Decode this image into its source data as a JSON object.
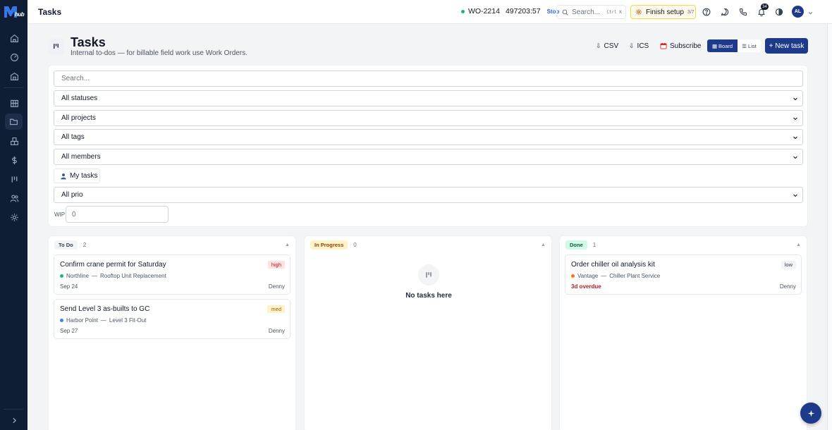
{
  "topbar": {
    "page_title": "Tasks",
    "timer": {
      "work_order": "WO-2214",
      "elapsed": "497203:57",
      "stop_label": "Stop"
    },
    "search_placeholder": "Search...",
    "search_shortcut": "Ctrl K",
    "setup_label": "Finish setup",
    "setup_progress": "3/7",
    "notifications_count": "34",
    "avatar_initials": "AL"
  },
  "brand": {
    "logo_text": "MEPhub"
  },
  "header": {
    "title": "Tasks",
    "subtitle": "Internal to-dos — for billable field work use Work Orders.",
    "csv_label": "CSV",
    "ics_label": "ICS",
    "subscribe_label": "Subscribe",
    "view_board_label": "Board",
    "view_list_label": "List",
    "new_task_label": "+ New task"
  },
  "filters": {
    "search_placeholder": "Search...",
    "status": "All statuses",
    "projects": "All projects",
    "tags": "All tags",
    "members": "All members",
    "my_tasks_label": "My tasks",
    "priority": "All prio",
    "wip_label": "WIP",
    "wip_value": "0"
  },
  "board": {
    "columns": [
      {
        "status": "To Do",
        "count": "2",
        "chip_bg": "#f3f4f6",
        "chip_fg": "#374151",
        "cards": [
          {
            "title": "Confirm crane permit for Saturday",
            "priority": "high",
            "client": "Northline",
            "project": "Rooftop Unit Replacement",
            "due": "Sep 24",
            "assignee": "Denny"
          },
          {
            "title": "Send Level 3 as-builts to GC",
            "priority": "med",
            "client": "Harbor Point",
            "project": "Level 3 Fit-Out",
            "due": "Sep 27",
            "assignee": "Denny"
          }
        ]
      },
      {
        "status": "In Progress",
        "count": "0",
        "chip_bg": "#fef3c7",
        "chip_fg": "#92400e",
        "empty_text": "No tasks here"
      },
      {
        "status": "Done",
        "count": "1",
        "chip_bg": "#d1fae5",
        "chip_fg": "#065f46",
        "cards": [
          {
            "title": "Order chiller oil analysis kit",
            "priority": "low",
            "client": "Vantage",
            "project": "Chiller Plant Service",
            "due": "3d overdue",
            "assignee": "Denny"
          }
        ]
      }
    ],
    "sep": "—"
  },
  "colors": {
    "brand": "#1e3a8a",
    "rail": "#0f1d35",
    "prio_high_bg": "#fee2e2",
    "prio_high_fg": "#b91c1c",
    "prio_med_bg": "#fef3c7",
    "prio_med_fg": "#b45309",
    "prio_low_bg": "#f3f4f6",
    "prio_low_fg": "#374151",
    "dot_green": "#10b981",
    "dot_blue": "#3b82f6",
    "dot_orange": "#f97316"
  }
}
